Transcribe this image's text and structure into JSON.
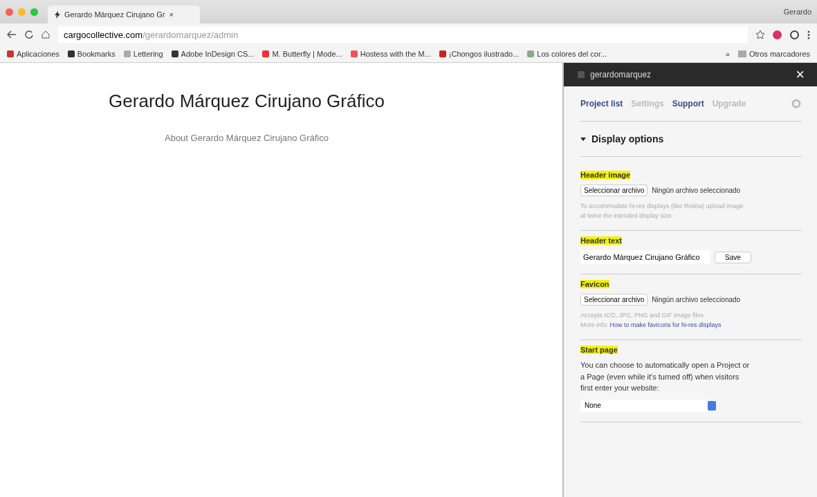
{
  "browser": {
    "tab_title": "Gerardo Márquez Cirujano Gr",
    "tab_close": "×",
    "profile": "Gerardo",
    "url_host": "cargocollective.com",
    "url_path": "/gerardomarquez/admin",
    "bookmarks": [
      "Aplicaciones",
      "Bookmarks",
      "Lettering",
      "Adobe InDesign CS...",
      "M. Butterfly | Mode...",
      "Hostess with the M...",
      "¡Chongos ilustrado...",
      "Los colores del cor..."
    ],
    "more_bookmarks": "»",
    "other_bookmarks": "Otros marcadores"
  },
  "page": {
    "title": "Gerardo Márquez Cirujano Gráfico",
    "link": "About Gerardo Márquez Cirujano Gráfico"
  },
  "panel": {
    "username": "gerardomarquez",
    "close": "×",
    "tabs": [
      {
        "label": "Project list",
        "selected": true
      },
      {
        "label": "Settings",
        "selected": false
      },
      {
        "label": "Support",
        "selected": true
      },
      {
        "label": "Upgrade",
        "selected": false
      }
    ],
    "section": {
      "title": "Display options",
      "expanded": true
    },
    "groups": [
      {
        "kind": "file",
        "label": "Header image",
        "button": "Seleccionar archivo",
        "status": "Ningún archivo seleccionado",
        "hint": "To accommodate hi-res displays (like Retina) upload image at twice the intended display size."
      },
      {
        "kind": "text",
        "label": "Header text",
        "value": "Gerardo Márquez Cirujano Gráfico",
        "button": "Save"
      },
      {
        "kind": "file",
        "label": "Favicon",
        "button": "Seleccionar archivo",
        "status": "Ningún archivo seleccionado",
        "hint": "Accepts ICO, JPG, PNG and GIF image files.",
        "hint2": "More info:",
        "link": "How to make favicons for hi-res displays"
      },
      {
        "kind": "select",
        "label": "Start page",
        "text": "You can choose to automatically open a Project or a Page (even while it's turned off) when visitors first enter your website:",
        "value": "None"
      }
    ]
  }
}
